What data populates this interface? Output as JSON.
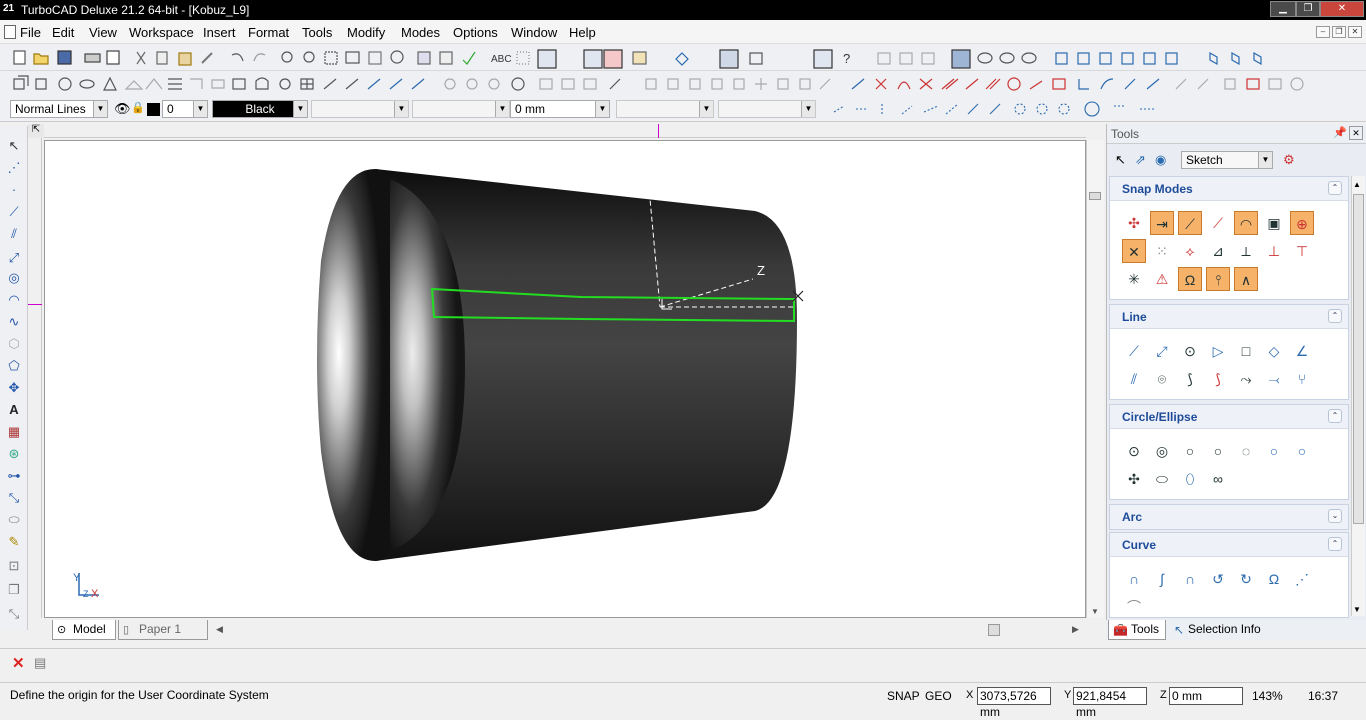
{
  "window": {
    "app_icon": "21",
    "title": "TurboCAD Deluxe 21.2 64-bit - [Kobuz_L9]",
    "minimize": "▁",
    "maximize": "❐",
    "close": "✕"
  },
  "menu": [
    "File",
    "Edit",
    "View",
    "Workspace",
    "Insert",
    "Format",
    "Tools",
    "Modify",
    "Modes",
    "Options",
    "Window",
    "Help"
  ],
  "mdi_controls": {
    "minimize": "–",
    "restore": "❐",
    "close": "✕"
  },
  "propbar": {
    "line_style": "Normal Lines",
    "layer_value": "0",
    "color": "Black",
    "width": "0 mm"
  },
  "viewport": {
    "axis_label_z": "Z",
    "ucs_labels": {
      "y": "Y",
      "z": "Z",
      "x": "X"
    }
  },
  "tabs": {
    "model": "Model",
    "paper": "Paper 1"
  },
  "panel": {
    "title": "Tools",
    "mode_select": "Sketch",
    "sections": [
      {
        "title": "Snap Modes",
        "state": "expanded"
      },
      {
        "title": "Line",
        "state": "expanded"
      },
      {
        "title": "Circle/Ellipse",
        "state": "expanded"
      },
      {
        "title": "Arc",
        "state": "collapsed"
      },
      {
        "title": "Curve",
        "state": "expanded"
      }
    ],
    "bottom_tabs": {
      "tools": "Tools",
      "selection": "Selection Info"
    }
  },
  "status": {
    "message": "Define the origin for the User Coordinate System",
    "snap": "SNAP",
    "geo": "GEO",
    "x_label": "X",
    "x_value": "3073,5726 mm",
    "y_label": "Y",
    "y_value": "921,8454 mm",
    "z_label": "Z",
    "z_value": "0 mm",
    "zoom": "143%",
    "time": "16:37"
  },
  "colors": {
    "accent_orange": "#f7b26a",
    "section_title_blue": "#1e4b99",
    "selection_green": "#22dd22"
  }
}
